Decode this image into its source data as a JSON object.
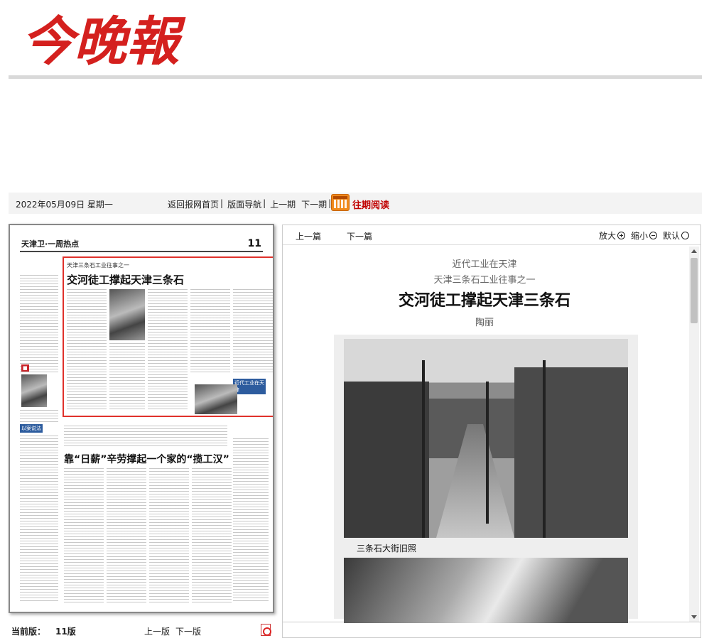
{
  "masthead": {
    "logo_text": "今晚報",
    "logo_color": "#d4201e"
  },
  "nav": {
    "date": "2022年05月09日 星期一",
    "links": [
      "返回报网首页",
      "版面导航",
      "上一期",
      "下一期"
    ],
    "archive_label": "往期阅读",
    "calendar_icon": "calendar-icon"
  },
  "page_thumb": {
    "section_title": "天津卫·一周热点",
    "page_number": "11",
    "highlight_kicker": "天津三条石工业往事之一",
    "highlight_title": "交河徒工撑起天津三条石",
    "lower_title": "靠“日薪”辛劳撑起一个家的“揽工汉”",
    "label_red": "近代工业在天津",
    "label_side": "以案说法"
  },
  "edition": {
    "label": "当前版：",
    "number": "11版",
    "prev": "上一版",
    "next": "下一版"
  },
  "article_nav": {
    "prev": "上一篇",
    "next": "下一篇",
    "zoom_in": "放大",
    "zoom_out": "缩小",
    "default": "默认"
  },
  "article": {
    "kicker1": "近代工业在天津",
    "kicker2": "天津三条石工业往事之一",
    "title": "交河徒工撑起天津三条石",
    "author": "陶丽",
    "caption": "三条石大街旧照"
  },
  "colors": {
    "accent_red": "#c00000",
    "highlight_border": "#e0312b"
  }
}
